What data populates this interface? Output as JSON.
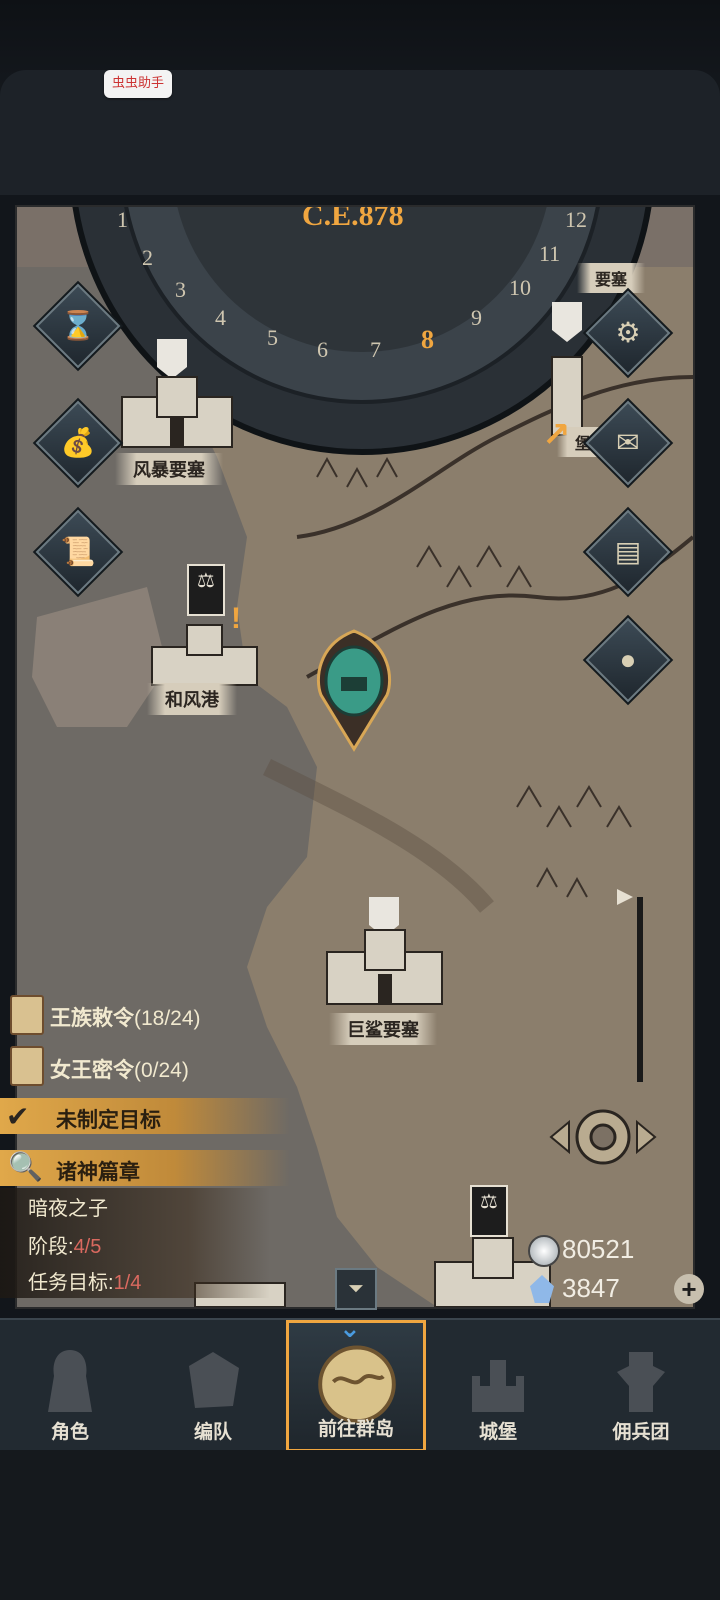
{
  "helper_badge": "虫虫助手",
  "calendar": {
    "year_label": "C.E.878",
    "months": [
      "1",
      "2",
      "3",
      "4",
      "5",
      "6",
      "7",
      "8",
      "9",
      "10",
      "11",
      "12"
    ],
    "current_month": "8"
  },
  "map": {
    "locations": [
      {
        "name": "风暴要塞"
      },
      {
        "name": "和风港"
      },
      {
        "name": "巨鲨要塞"
      },
      {
        "name": "要塞"
      },
      {
        "name": "堡"
      }
    ]
  },
  "side_buttons": [
    {
      "icon": "hourglass-icon"
    },
    {
      "icon": "money-bag-icon"
    },
    {
      "icon": "scroll-icon"
    },
    {
      "icon": "gear-icon"
    },
    {
      "icon": "mail-icon"
    },
    {
      "icon": "book-icon"
    },
    {
      "icon": "coin-icon"
    }
  ],
  "quests": {
    "royal_edict": {
      "label": "王族敕令",
      "count": "(18/24)"
    },
    "queen_secret": {
      "label": "女王密令",
      "count": "(0/24)"
    },
    "no_target": "未制定目标",
    "chapter": "诸神篇章",
    "chapter_title": "暗夜之子",
    "stage_label": "阶段:",
    "stage_value": "4/5",
    "task_label": "任务目标:",
    "task_value": "1/4"
  },
  "resources": {
    "silver": "80521",
    "crystal": "3847"
  },
  "nav": [
    {
      "label": "角色"
    },
    {
      "label": "编队"
    },
    {
      "label": "前往群岛"
    },
    {
      "label": "城堡"
    },
    {
      "label": "佣兵团"
    }
  ],
  "colors": {
    "accent": "#f0a640",
    "highlight_quest": "#e0a84a",
    "stage_red": "#d9695f"
  }
}
